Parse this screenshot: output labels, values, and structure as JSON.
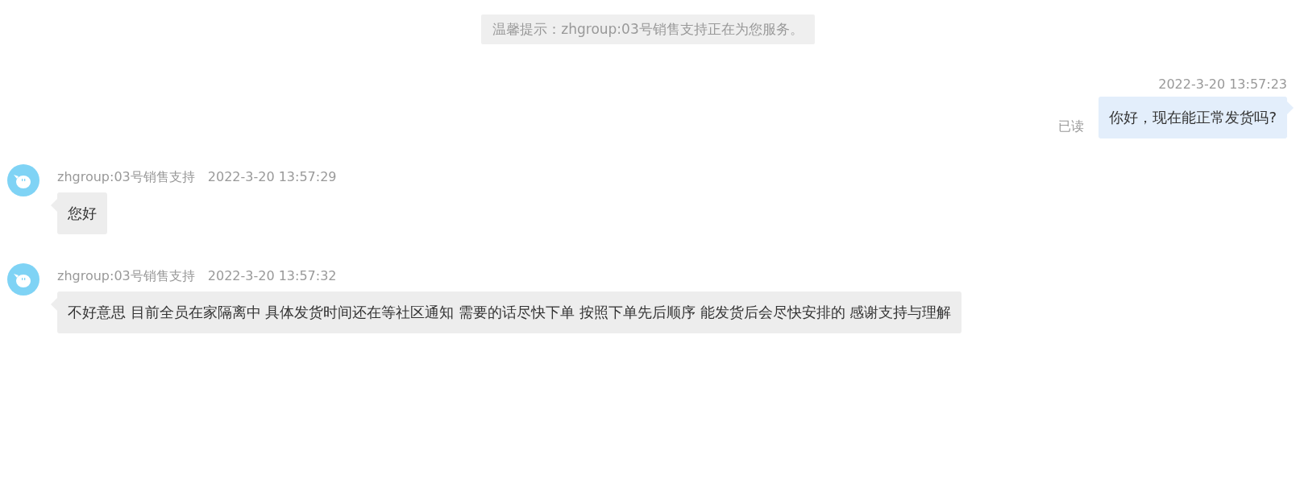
{
  "notice": "温馨提示：zhgroup:03号销售支持正在为您服务。",
  "messages": [
    {
      "kind": "outgoing",
      "time": "2022-3-20 13:57:23",
      "text": "你好，现在能正常发货吗?",
      "status": "已读"
    },
    {
      "kind": "incoming",
      "sender": "zhgroup:03号销售支持",
      "time": "2022-3-20 13:57:29",
      "text": "您好"
    },
    {
      "kind": "incoming",
      "sender": "zhgroup:03号销售支持",
      "time": "2022-3-20 13:57:32",
      "text": "不好意思 目前全员在家隔离中 具体发货时间还在等社区通知 需要的话尽快下单 按照下单先后顺序 能发货后会尽快安排的 感谢支持与理解"
    }
  ]
}
